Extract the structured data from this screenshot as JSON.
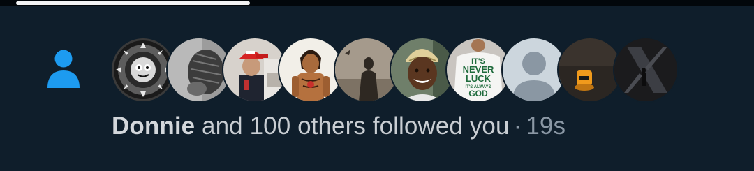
{
  "notification": {
    "type_icon": "person-icon",
    "accent_color": "#1d9bf0",
    "actor_name": "Donnie",
    "message": "and 100 others followed you",
    "separator": "·",
    "timestamp": "19s",
    "avatars": [
      {
        "icon": "wheel-emblem-avatar"
      },
      {
        "icon": "braids-avatar"
      },
      {
        "icon": "red-cap-child-avatar"
      },
      {
        "icon": "cartoon-figure-avatar"
      },
      {
        "icon": "sepia-figure-avatar"
      },
      {
        "icon": "smiling-man-avatar"
      },
      {
        "icon": "never-luck-shirt-avatar"
      },
      {
        "icon": "default-profile-avatar"
      },
      {
        "icon": "cartoon-character-avatar"
      },
      {
        "icon": "x-logo-avatar"
      }
    ],
    "shirt_text": [
      "IT'S",
      "NEVER",
      "LUCK",
      "IT'S ALWAYS",
      "GOD"
    ]
  },
  "status": {
    "progress": 0.31
  }
}
